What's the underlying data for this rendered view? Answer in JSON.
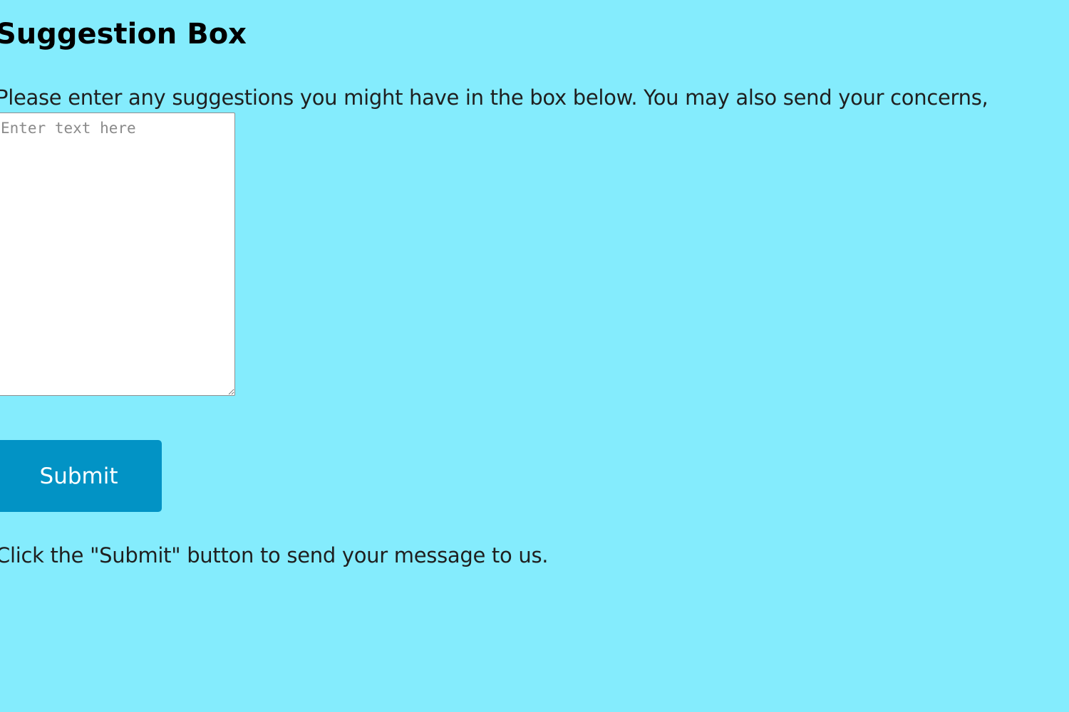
{
  "page": {
    "title": "Suggestion Box",
    "intro_text": "Please enter any suggestions you might have in the box below. You may also send your concerns,",
    "hint_text": "Click the \"Submit\" button to send your message to us."
  },
  "form": {
    "textarea_placeholder": "Enter text here",
    "submit_label": "Submit"
  },
  "colors": {
    "background": "#84ecfd",
    "button": "#0293c5",
    "button_text": "#ffffff"
  }
}
